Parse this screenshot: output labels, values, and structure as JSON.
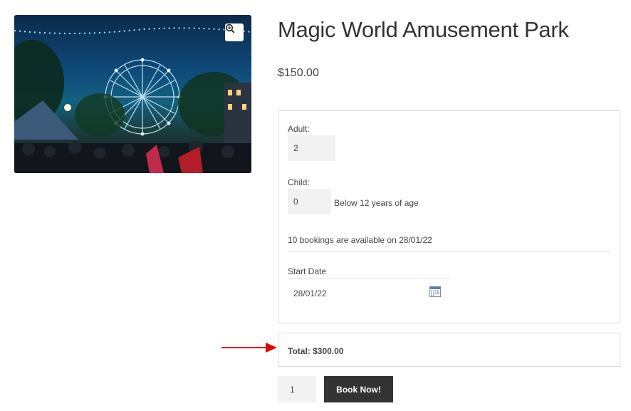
{
  "product": {
    "title": "Magic World Amusement Park",
    "price": "$150.00",
    "image_subject": "ferris-wheel-night-photo"
  },
  "booking": {
    "adult_label": "Adult:",
    "adult_value": "2",
    "child_label": "Child:",
    "child_value": "0",
    "child_hint": "Below 12 years of age",
    "availability": "10 bookings are available on 28/01/22",
    "start_date_label": "Start Date",
    "start_date_value": "28/01/22"
  },
  "total": {
    "text": "Total: $300.00"
  },
  "cart": {
    "quantity": "1",
    "book_label": "Book Now!"
  },
  "colors": {
    "accent_arrow": "#e00000",
    "button_bg": "#333333",
    "input_bg": "#f2f2f2"
  }
}
